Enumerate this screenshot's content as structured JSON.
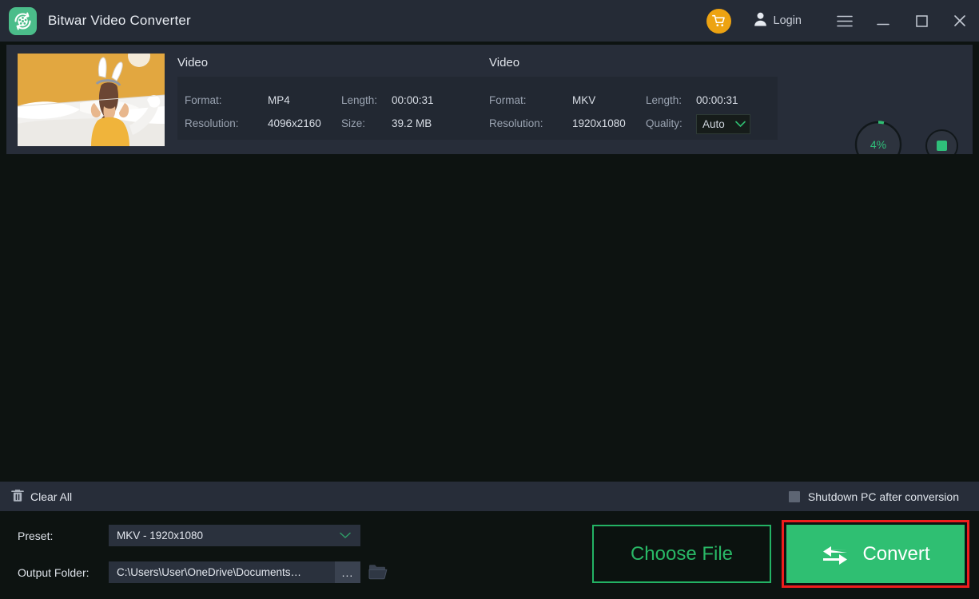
{
  "window": {
    "app_title": "Bitwar Video Converter",
    "logo_icon": "film-reel-convert-icon",
    "cart_icon": "shopping-cart-icon",
    "account_icon": "user-avatar-icon",
    "login_label": "Login",
    "menu_icon": "hamburger-menu-icon",
    "minimize_icon": "minimize-icon",
    "maximize_icon": "maximize-icon",
    "close_icon": "close-icon"
  },
  "colors": {
    "accent_green": "#2fbf72",
    "titlebar_bg": "#252b36",
    "card_bg": "#272d39",
    "infobox_bg": "#222832",
    "body_bg": "#0d1311",
    "cart_orange": "#eda312",
    "highlight_red": "#ef1d1d",
    "field_bg": "#2a313d"
  },
  "card": {
    "thumbnail_name": "video-thumbnail",
    "arrow_icon": "convert-arrow-icon",
    "source": {
      "heading": "Video",
      "format_label": "Format:",
      "format_value": "MP4",
      "length_label": "Length:",
      "length_value": "00:00:31",
      "resolution_label": "Resolution:",
      "resolution_value": "4096x2160",
      "size_label": "Size:",
      "size_value": "39.2 MB"
    },
    "target": {
      "heading": "Video",
      "format_label": "Format:",
      "format_value": "MKV",
      "length_label": "Length:",
      "length_value": "00:00:31",
      "resolution_label": "Resolution:",
      "resolution_value": "1920x1080",
      "quality_label": "Quality:",
      "quality_value": "Auto",
      "quality_chevron_icon": "chevron-down-icon"
    },
    "progress": {
      "percent_label": "4%",
      "percent_value": 4
    },
    "stop_button": {
      "icon": "stop-square-icon"
    }
  },
  "strip": {
    "clear_all_icon": "trash-icon",
    "clear_all_label": "Clear All",
    "shutdown_checkbox_checked": false,
    "shutdown_label": "Shutdown PC after conversion"
  },
  "bottom": {
    "preset_label": "Preset:",
    "preset_value": "MKV - 1920x1080",
    "preset_chevron_icon": "chevron-down-icon",
    "output_label": "Output Folder:",
    "output_value": "C:\\Users\\User\\OneDrive\\Documents…",
    "browse_dots_label": "...",
    "folder_icon": "open-folder-icon",
    "choose_file_label": "Choose File",
    "convert_label": "Convert",
    "convert_icon": "swap-arrows-icon"
  }
}
